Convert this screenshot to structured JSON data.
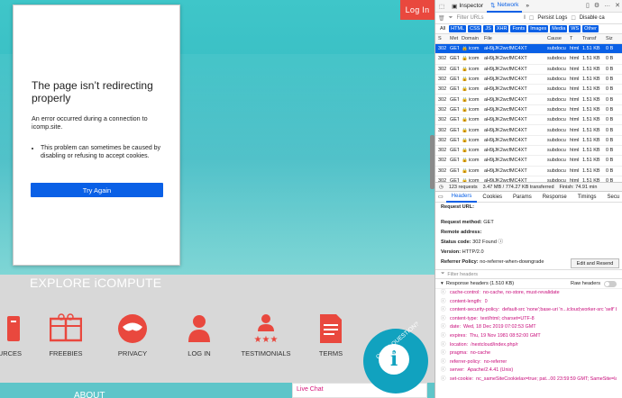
{
  "site": {
    "login_label": "Log In",
    "error_title": "The page isn’t redirecting properly",
    "error_msg": "An error occurred during a connection to icomp.site.",
    "error_hint": "This problem can sometimes be caused by disabling or refusing to accept cookies.",
    "try_again": "Try Again",
    "explore": "EXPLORE iCOMPUTE",
    "nav": [
      {
        "label": "OURCES",
        "icon": "book-icon"
      },
      {
        "label": "FREEBIES",
        "icon": "gift-icon"
      },
      {
        "label": "PRIVACY",
        "icon": "mask-icon"
      },
      {
        "label": "LOG IN",
        "icon": "user-icon"
      },
      {
        "label": "TESTIMONIALS",
        "icon": "star-user-icon"
      },
      {
        "label": "TERMS",
        "icon": "document-icon"
      }
    ],
    "about": "ABOUT",
    "live_chat": "Live Chat",
    "quick_question": "QUICK QUESTION? Ask us",
    "colors": {
      "accent": "#e9483e",
      "teal": "#3fc6c9",
      "button_blue": "#0a60e6"
    }
  },
  "devtools": {
    "tabs": [
      {
        "label": "Inspector",
        "active": false
      },
      {
        "label": "Network",
        "active": true
      }
    ],
    "filter_placeholder": "Filter URLs",
    "persist_logs": "Persist Logs",
    "disable_cache": "Disable ca",
    "types": [
      "All",
      "HTML",
      "CSS",
      "JS",
      "XHR",
      "Fonts",
      "Images",
      "Media",
      "WS",
      "Other"
    ],
    "columns": [
      "S",
      "Met",
      "Domain",
      "File",
      "Cause",
      "T",
      "Transf",
      "Siz"
    ],
    "requests": {
      "status": "302",
      "method": "GET",
      "domain": "icom",
      "file": "aH9jJK2wcfMC4XT",
      "cause": "subdocu",
      "type": "html",
      "transferred": "1.51 KB",
      "size": "0 B",
      "count": 14
    },
    "summary": {
      "requests": "123 requests",
      "transferred": "3.47 MB / 774.27 KB transferred",
      "finish": "Finish: 74.91 min"
    },
    "detail_tabs": [
      "Headers",
      "Cookies",
      "Params",
      "Response",
      "Timings",
      "Secu"
    ],
    "request_url_label": "Request URL:",
    "request_method": {
      "label": "Request method:",
      "value": "GET"
    },
    "remote_address": {
      "label": "Remote address:",
      "value": ""
    },
    "status_code": {
      "label": "Status code:",
      "value": "302 Found"
    },
    "version": {
      "label": "Version:",
      "value": "HTTP/2.0"
    },
    "referrer_policy": {
      "label": "Referrer Policy:",
      "value": "no-referrer-when-downgrade"
    },
    "edit_resend": "Edit and Resend",
    "filter_headers": "Filter headers",
    "response_headers": "Response headers (1.510 KB)",
    "raw_headers": "Raw headers",
    "headers": [
      {
        "name": "cache-control:",
        "value": "no-cache, no-store, must-revalidate"
      },
      {
        "name": "content-length:",
        "value": "0"
      },
      {
        "name": "content-security-policy:",
        "value": "default-src 'none';base-uri 'n...icloud;worker-src 'self' blob:"
      },
      {
        "name": "content-type:",
        "value": "text/html; charset=UTF-8"
      },
      {
        "name": "date:",
        "value": "Wed, 18 Dec 2019 07:02:53 GMT"
      },
      {
        "name": "expires:",
        "value": "Thu, 19 Nov 1981 08:52:00 GMT"
      },
      {
        "name": "location:",
        "value": "/nextcloud/index.php/r"
      },
      {
        "name": "pragma:",
        "value": "no-cache"
      },
      {
        "name": "referrer-policy:",
        "value": "no-referrer"
      },
      {
        "name": "server:",
        "value": "Apache/2.4.41 (Unix)"
      },
      {
        "name": "set-cookie:",
        "value": "nc_sameSiteCookielax=true; pat...00 23:59:59 GMT; SameSite=lax"
      }
    ]
  }
}
